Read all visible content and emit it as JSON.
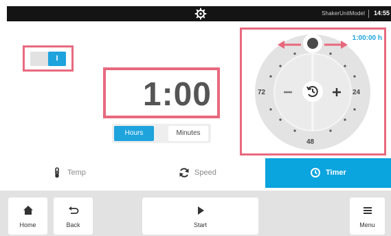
{
  "topbar": {
    "model": "ShakerUnitModel",
    "time": "14:55",
    "icon": "gear-icon"
  },
  "toggle": {
    "state_label": "I",
    "state": "on",
    "accent": "#1ea3dd"
  },
  "timer": {
    "value": "1:00",
    "units": [
      "Hours",
      "Minutes"
    ],
    "selected_unit": "Hours"
  },
  "dial": {
    "readout": "1:00:00 h",
    "labels": {
      "left": "72",
      "right": "24",
      "bottom": "48"
    },
    "minus_icon": "minus-icon",
    "plus_icon": "plus-icon",
    "center_icon": "timer-reset-icon"
  },
  "modes": [
    {
      "label": "Temp",
      "icon": "thermometer-icon",
      "active": false
    },
    {
      "label": "Speed",
      "icon": "refresh-icon",
      "active": false
    },
    {
      "label": "Timer",
      "icon": "clock-icon",
      "active": true
    }
  ],
  "nav": {
    "home": "Home",
    "back": "Back",
    "start": "Start",
    "menu": "Menu"
  },
  "colors": {
    "accent": "#1ea3dd",
    "highlight": "#e8697e",
    "topbar": "#141414"
  }
}
